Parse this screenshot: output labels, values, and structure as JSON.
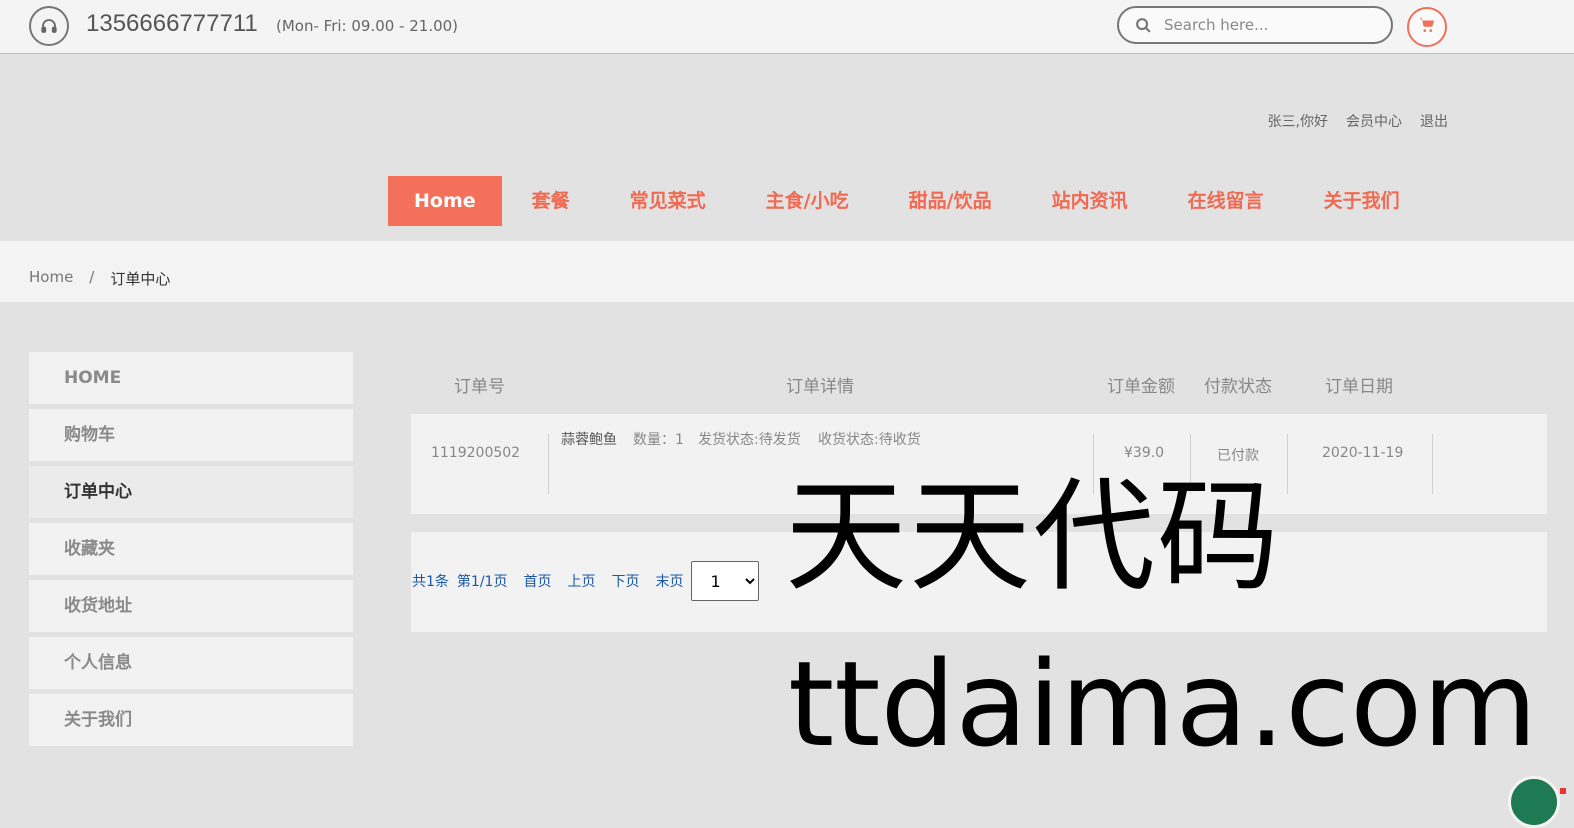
{
  "topbar": {
    "phone_icon": "headset-icon",
    "phone_number": "1356666777711",
    "hours": "(Mon- Fri: 09.00 - 21.00)",
    "search_placeholder": "Search here...",
    "search_icon": "search-icon",
    "cart_icon": "cart-icon",
    "accent_color": "#f5705a"
  },
  "user_links": {
    "greeting": "张三,你好",
    "member_center": "会员中心",
    "logout": "退出"
  },
  "nav": {
    "items": [
      {
        "label": "Home",
        "active": true
      },
      {
        "label": "套餐"
      },
      {
        "label": "常见菜式"
      },
      {
        "label": "主食/小吃"
      },
      {
        "label": "甜品/饮品"
      },
      {
        "label": "站内资讯"
      },
      {
        "label": "在线留言"
      },
      {
        "label": "关于我们"
      }
    ]
  },
  "breadcrumb": {
    "home": "Home",
    "separator": "/",
    "current": "订单中心"
  },
  "sidebar": {
    "items": [
      {
        "label": "HOME"
      },
      {
        "label": "购物车"
      },
      {
        "label": "订单中心",
        "active": true
      },
      {
        "label": "收藏夹"
      },
      {
        "label": "收货地址"
      },
      {
        "label": "个人信息"
      },
      {
        "label": "关于我们"
      }
    ]
  },
  "orders": {
    "headers": [
      "订单号",
      "订单详情",
      "订单金额",
      "付款状态",
      "订单日期"
    ],
    "rows": [
      {
        "order_no": "1119200502",
        "item_name": "蒜蓉鲍鱼",
        "quantity": "数量：1",
        "ship_status": "发货状态:待发货",
        "receive_status": "收货状态:待收货",
        "amount": "¥39.0",
        "pay_status": "已付款",
        "date": "2020-11-19"
      }
    ]
  },
  "pager": {
    "total": "共1条",
    "page_info": "第1/1页",
    "first": "首页",
    "prev": "上页",
    "next": "下页",
    "last": "末页",
    "selected_page": "1"
  },
  "watermark": {
    "cn": "天天代码",
    "en": "ttdaima.com"
  }
}
